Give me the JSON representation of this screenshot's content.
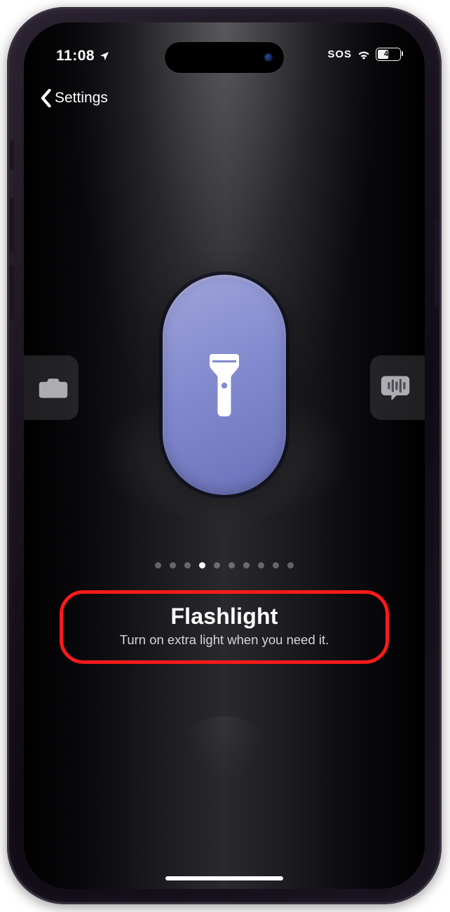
{
  "status": {
    "time": "11:08",
    "location_icon": "location-arrow",
    "sos": "SOS",
    "battery_pct": "43",
    "battery_fill_pct": 43
  },
  "nav": {
    "back_label": "Settings"
  },
  "carousel": {
    "prev_icon": "camera-icon",
    "next_icon": "voice-memo-icon",
    "selected_icon": "flashlight-icon",
    "page_count": 10,
    "active_index": 3
  },
  "caption": {
    "title": "Flashlight",
    "subtitle": "Turn on extra light when you need it."
  },
  "annotation": {
    "highlight_color": "#ff1a1a"
  }
}
